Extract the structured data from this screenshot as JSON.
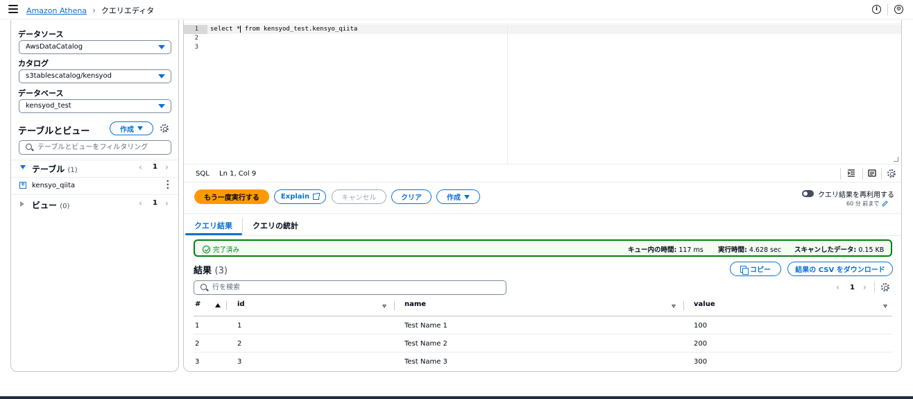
{
  "header": {
    "breadcrumbs": [
      "Amazon Athena",
      "クエリエディタ"
    ],
    "info_icon": "info-icon",
    "settings_icon": "settings-icon"
  },
  "sidebar": {
    "datasource_label": "データソース",
    "datasource_value": "AwsDataCatalog",
    "catalog_label": "カタログ",
    "catalog_value": "s3tablescatalog/kensyod",
    "database_label": "データベース",
    "database_value": "kensyod_test",
    "tables_views_title": "テーブルとビュー",
    "create_label": "作成",
    "filter_placeholder": "テーブルとビューをフィルタリング",
    "tables": {
      "label": "テーブル",
      "count": "(1)",
      "page": "1",
      "items": [
        "kensyo_qiita"
      ]
    },
    "views": {
      "label": "ビュー",
      "count": "(0)",
      "page": "1"
    }
  },
  "editor": {
    "lines": [
      "1",
      "2",
      "3"
    ],
    "code_line1_a": "select *",
    "code_line1_b": " from kensyod_test.kensyo_qiita",
    "language": "SQL",
    "position": "Ln 1, Col 9"
  },
  "actions": {
    "run_again": "もう一度実行する",
    "explain": "Explain",
    "cancel": "キャンセル",
    "clear": "クリア",
    "create": "作成",
    "reuse_label": "クエリ結果を再利用する",
    "reuse_sub": "60 分 前まで"
  },
  "tabs": {
    "results": "クエリ結果",
    "stats": "クエリの統計"
  },
  "status": {
    "state": "完了済み",
    "queue_label": "キュー内の時間:",
    "queue_value": "117 ms",
    "exec_label": "実行時間:",
    "exec_value": "4.628 sec",
    "scanned_label": "スキャンしたデータ:",
    "scanned_value": "0.15 KB"
  },
  "results": {
    "title": "結果",
    "count": "(3)",
    "copy": "コピー",
    "download": "結果の CSV をダウンロード",
    "search_placeholder": "行を検索",
    "page": "1",
    "columns": [
      "#",
      "id",
      "name",
      "value"
    ],
    "rows": [
      [
        "1",
        "1",
        "Test Name 1",
        "100"
      ],
      [
        "2",
        "2",
        "Test Name 2",
        "200"
      ],
      [
        "3",
        "3",
        "Test Name 3",
        "300"
      ]
    ]
  },
  "colors": {
    "accent": "#0972d3",
    "primary_button": "#ff9900",
    "success": "#037f0c"
  }
}
